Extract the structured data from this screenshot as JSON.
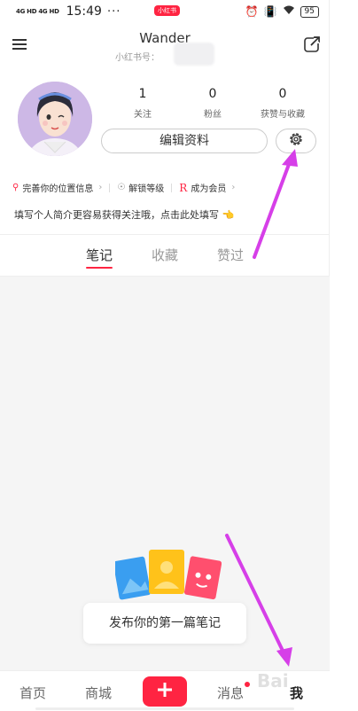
{
  "status_bar": {
    "network": "4G HD 4G HD",
    "time": "15:49",
    "dots": "···",
    "app_badge": "小红书",
    "battery": "95"
  },
  "header": {
    "title": "Wander",
    "subtitle": "小红书号："
  },
  "stats": [
    {
      "value": "1",
      "label": "关注"
    },
    {
      "value": "0",
      "label": "粉丝"
    },
    {
      "value": "0",
      "label": "获赞与收藏"
    }
  ],
  "edit_profile_label": "编辑资料",
  "chips": [
    {
      "label": "完善你的位置信息",
      "icon": "location-icon"
    },
    {
      "label": "解锁等级",
      "icon": "medal-icon"
    },
    {
      "label": "成为会员",
      "icon": "r-icon"
    }
  ],
  "bio_prompt": "填写个人简介更容易获得关注哦，点击此处填写 👈",
  "tabs": [
    {
      "label": "笔记",
      "active": true
    },
    {
      "label": "收藏",
      "active": false
    },
    {
      "label": "赞过",
      "active": false
    }
  ],
  "empty_state": "发布你的第一篇笔记",
  "bottom_nav": [
    {
      "label": "首页"
    },
    {
      "label": "商城"
    },
    {
      "label": "消息"
    },
    {
      "label": "我"
    }
  ],
  "colors": {
    "accent": "#ff2442",
    "annotation_arrow": "#d63fe8"
  },
  "watermark": "Bai"
}
